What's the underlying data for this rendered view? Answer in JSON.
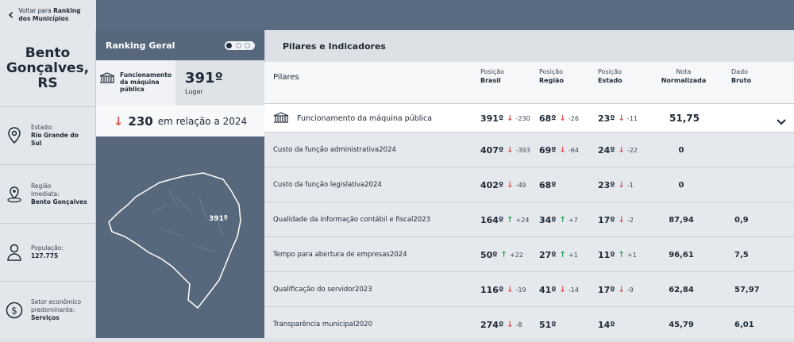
{
  "back": {
    "line1": "Voltar para",
    "line1_bold": "Ranking",
    "line2": "dos Municípios"
  },
  "city": {
    "line1": "Bento",
    "line2": "Gonçalves,",
    "line3": "RS"
  },
  "info": [
    {
      "icon": "map-pin-icon",
      "label": "Estado:",
      "value1": "Rio Grande do",
      "value2": "Sul"
    },
    {
      "icon": "location-icon",
      "label": "Região",
      "label2": "Imediata:",
      "value1": "Bento Gonçalves",
      "value2": ""
    },
    {
      "icon": "person-icon",
      "label": "População:",
      "value1": "127.775",
      "value2": ""
    },
    {
      "icon": "dollar-icon",
      "label": "Setor econômico",
      "label2": "predominante:",
      "value1": "Serviços",
      "value2": ""
    }
  ],
  "ranking": {
    "title": "Ranking Geral",
    "pillar_line1": "Funcionamento",
    "pillar_line2": "da máquina",
    "pillar_line3": "pública",
    "position": "391º",
    "position_label": "Lugar",
    "change": "230",
    "change_text": "em relação a 2024",
    "map_label": "391º"
  },
  "right": {
    "title": "Pilares e Indicadores",
    "headers": {
      "pilares": "Pilares",
      "brasil1": "Posição",
      "brasil2": "Brasil",
      "regiao1": "Posição",
      "regiao2": "Região",
      "estado1": "Posição",
      "estado2": "Estado",
      "nota1": "Nota",
      "nota2": "Normalizada",
      "dado1": "Dado",
      "dado2": "Bruto"
    },
    "main_row": {
      "label": "Funcionamento da máquina pública",
      "brasil": "391º",
      "brasil_d": "-230",
      "brasil_dir": "down",
      "regiao": "68º",
      "regiao_d": "-26",
      "regiao_dir": "down",
      "estado": "23º",
      "estado_d": "-11",
      "estado_dir": "down",
      "nota": "51,75",
      "dado": ""
    },
    "rows": [
      {
        "label": "Custo da função administrativa",
        "year": "2024",
        "brasil": "407º",
        "brasil_d": "-393",
        "brasil_dir": "down",
        "regiao": "69º",
        "regiao_d": "-64",
        "regiao_dir": "down",
        "estado": "24º",
        "estado_d": "-22",
        "estado_dir": "down",
        "nota": "0",
        "dado": ""
      },
      {
        "label": "Custo da função legislativa",
        "year": "2024",
        "brasil": "402º",
        "brasil_d": "-49",
        "brasil_dir": "down",
        "regiao": "68º",
        "regiao_d": "",
        "regiao_dir": "",
        "estado": "23º",
        "estado_d": "-1",
        "estado_dir": "down",
        "nota": "0",
        "dado": ""
      },
      {
        "label": "Qualidade da informação contábil e fiscal",
        "year": "2023",
        "brasil": "164º",
        "brasil_d": "+24",
        "brasil_dir": "up",
        "regiao": "34º",
        "regiao_d": "+7",
        "regiao_dir": "up",
        "estado": "17º",
        "estado_d": "-2",
        "estado_dir": "down",
        "nota": "87,94",
        "dado": "0,9"
      },
      {
        "label": "Tempo para abertura de empresas",
        "year": "2024",
        "brasil": "50º",
        "brasil_d": "+22",
        "brasil_dir": "up",
        "regiao": "27º",
        "regiao_d": "+1",
        "regiao_dir": "up",
        "estado": "11º",
        "estado_d": "+1",
        "estado_dir": "up",
        "nota": "96,61",
        "dado": "7,5"
      },
      {
        "label": "Qualificação do servidor",
        "year": "2023",
        "brasil": "116º",
        "brasil_d": "-19",
        "brasil_dir": "down",
        "regiao": "41º",
        "regiao_d": "-14",
        "regiao_dir": "down",
        "estado": "17º",
        "estado_d": "-9",
        "estado_dir": "down",
        "nota": "62,84",
        "dado": "57,97"
      },
      {
        "label": "Transparência municipal",
        "year": "2020",
        "brasil": "274º",
        "brasil_d": "-8",
        "brasil_dir": "down",
        "regiao": "51º",
        "regiao_d": "",
        "regiao_dir": "",
        "estado": "14º",
        "estado_d": "",
        "estado_dir": "",
        "nota": "45,79",
        "dado": "6,01"
      }
    ]
  },
  "colors": {
    "up": "#2e9e5b",
    "down": "#d9534f",
    "sidebar": "#58687c",
    "topbar": "#5a6a80"
  }
}
